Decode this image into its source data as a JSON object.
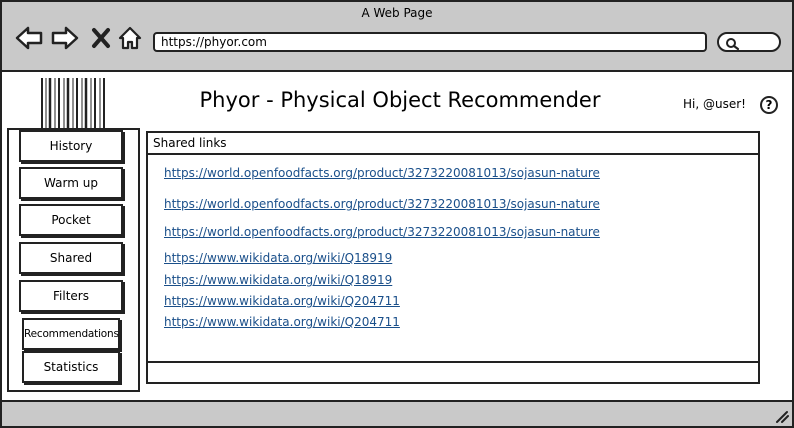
{
  "window": {
    "title": "A Web Page"
  },
  "browser": {
    "url": "https://phyor.com",
    "icons": [
      "back-arrow-icon",
      "forward-arrow-icon",
      "close-x-icon",
      "home-icon",
      "search-icon",
      "resize-grip-icon"
    ]
  },
  "header": {
    "title": "Phyor - Physical Object Recommender",
    "greeting": "Hi, @user!",
    "help": "?"
  },
  "sidebar": {
    "items": [
      {
        "label": "History"
      },
      {
        "label": "Warm up"
      },
      {
        "label": "Pocket"
      },
      {
        "label": "Shared"
      },
      {
        "label": "Filters"
      },
      {
        "label": "Recommendations"
      },
      {
        "label": "Statistics"
      }
    ]
  },
  "main": {
    "panel_title": "Shared links",
    "links": [
      "https://world.openfoodfacts.org/product/3273220081013/sojasun-nature",
      "https://world.openfoodfacts.org/product/3273220081013/sojasun-nature",
      "https://world.openfoodfacts.org/product/3273220081013/sojasun-nature",
      "https://www.wikidata.org/wiki/Q18919",
      "https://www.wikidata.org/wiki/Q18919",
      "https://www.wikidata.org/wiki/Q204711",
      "https://www.wikidata.org/wiki/Q204711"
    ]
  },
  "colors": {
    "chrome": "#c9c9c9",
    "link": "#1a4f8a",
    "ink": "#222222"
  }
}
